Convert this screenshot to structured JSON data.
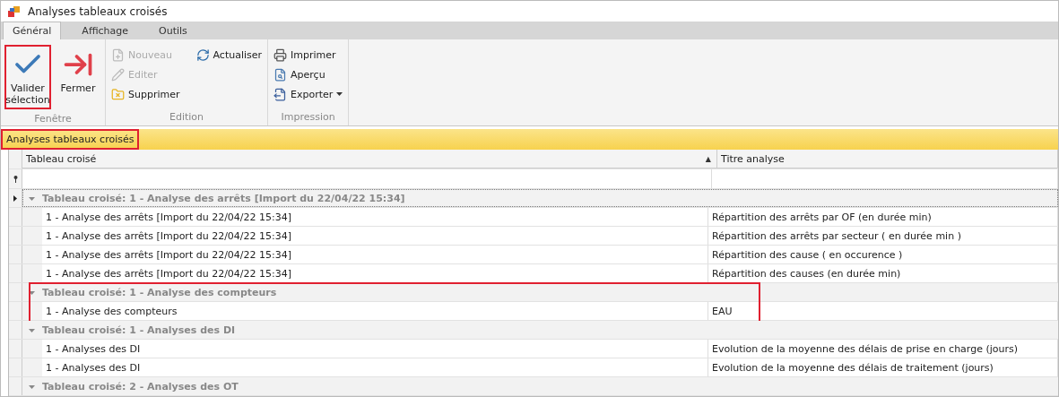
{
  "window": {
    "title": "Analyses tableaux croisés"
  },
  "tabs": [
    {
      "label": "Général",
      "selected": true
    },
    {
      "label": "Affichage",
      "selected": false
    },
    {
      "label": "Outils",
      "selected": false
    }
  ],
  "ribbon": [
    {
      "label": "Fenêtre",
      "buttons": [
        {
          "kind": "large",
          "label": "Valider sélection",
          "disabled": false,
          "highlighted": true
        },
        {
          "kind": "large",
          "label": "Fermer",
          "disabled": false,
          "highlighted": false
        }
      ]
    },
    {
      "label": "Edition",
      "buttons": [
        {
          "kind": "small",
          "label": "Nouveau",
          "disabled": true
        },
        {
          "kind": "small",
          "label": "Editer",
          "disabled": true
        },
        {
          "kind": "small",
          "label": "Supprimer",
          "disabled": false
        },
        {
          "kind": "small",
          "label": "Actualiser",
          "disabled": false
        }
      ]
    },
    {
      "label": "Impression",
      "buttons": [
        {
          "kind": "small",
          "label": "Imprimer",
          "disabled": false
        },
        {
          "kind": "small",
          "label": "Aperçu",
          "disabled": false
        },
        {
          "kind": "small",
          "label": "Exporter",
          "disabled": false,
          "dropdown": true
        }
      ]
    }
  ],
  "panel": {
    "title": "Analyses tableaux croisés",
    "highlighted": true
  },
  "grid": {
    "columns": [
      {
        "label": "Tableau croisé",
        "sort_mark": "▲"
      },
      {
        "label": "Titre analyse"
      }
    ],
    "groups": [
      {
        "label": "Tableau croisé: 1 - Analyse des arrêts [Import du 22/04/22 15:34]",
        "expanded": true,
        "focused": true,
        "highlighted": false,
        "rows": [
          [
            "1 - Analyse des arrêts [Import du 22/04/22 15:34]",
            "Répartition des arrêts par OF (en durée min)"
          ],
          [
            "1 - Analyse des arrêts [Import du 22/04/22 15:34]",
            "Répartition des arrêts par secteur ( en durée min )"
          ],
          [
            "1 - Analyse des arrêts [Import du 22/04/22 15:34]",
            "Répartition des cause ( en occurence )"
          ],
          [
            "1 - Analyse des arrêts [Import du 22/04/22 15:34]",
            "Répartition des causes (en durée min)"
          ]
        ]
      },
      {
        "label": "Tableau croisé: 1 - Analyse des compteurs",
        "expanded": true,
        "focused": false,
        "highlighted": true,
        "rows": [
          [
            "1 - Analyse des compteurs",
            "EAU"
          ]
        ]
      },
      {
        "label": "Tableau croisé: 1 - Analyses des DI",
        "expanded": true,
        "focused": false,
        "highlighted": false,
        "rows": [
          [
            "1 - Analyses des DI",
            "Evolution de la moyenne des délais de prise en charge (jours)"
          ],
          [
            "1 - Analyses des DI",
            "Evolution de la moyenne des délais de traitement (jours)"
          ]
        ]
      },
      {
        "label": "Tableau croisé: 2 - Analyses des OT",
        "expanded": true,
        "focused": false,
        "highlighted": false
      }
    ]
  }
}
